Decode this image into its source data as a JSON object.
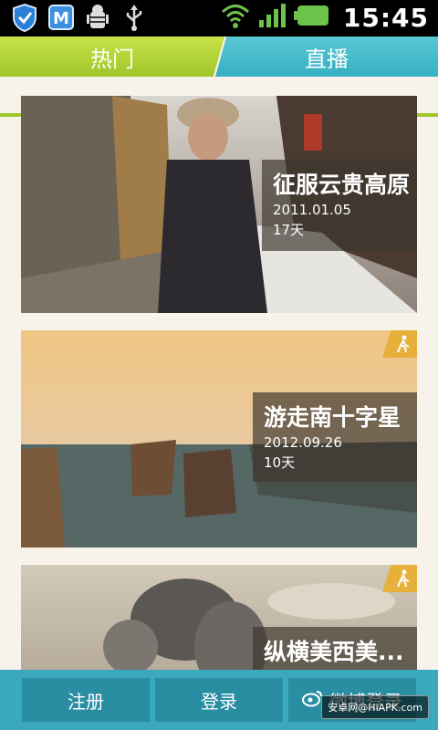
{
  "status_bar": {
    "time": "15:45",
    "icons_left": [
      "shield-check-icon",
      "m-app-icon",
      "android-debug-icon",
      "usb-icon"
    ],
    "icons_right": [
      "wifi-icon",
      "signal-icon",
      "battery-icon"
    ]
  },
  "tabs": [
    {
      "label": "热门",
      "active": true,
      "color": "#9fc62a"
    },
    {
      "label": "直播",
      "active": false,
      "color": "#37b0c2"
    }
  ],
  "cards": [
    {
      "title": "征服云贵高原",
      "date": "2011.01.05",
      "days": "17天",
      "badge": ""
    },
    {
      "title": "游走南十字星",
      "date": "2012.09.26",
      "days": "10天",
      "badge": "walking-icon"
    },
    {
      "title": "纵横美西美...",
      "date": "",
      "days": "",
      "badge": "walking-icon"
    }
  ],
  "bottom_bar": {
    "register": "注册",
    "login": "登录",
    "weibo_login": "微博登录"
  },
  "watermark": "安卓网@HiAPK.com"
}
